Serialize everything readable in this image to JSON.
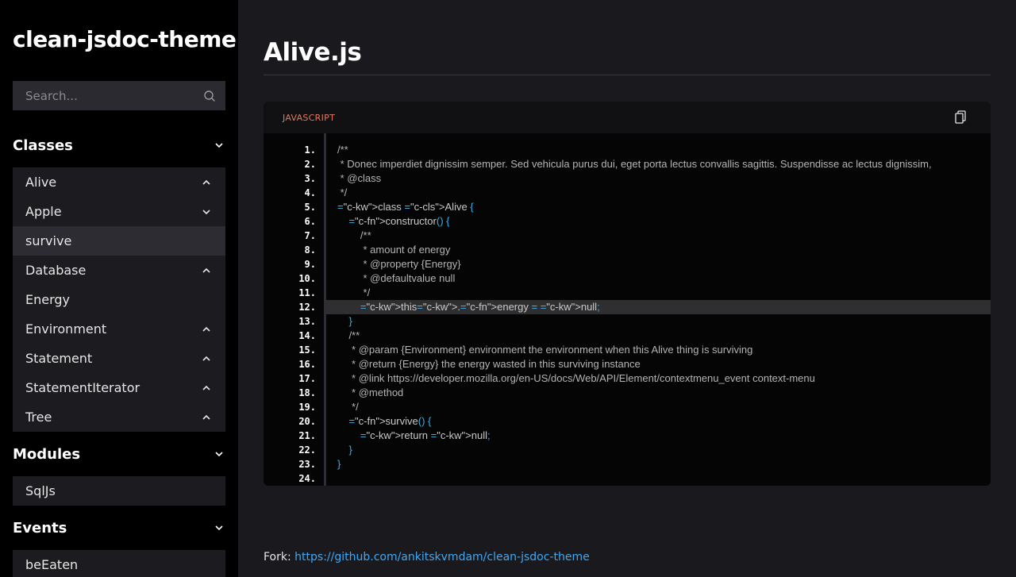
{
  "sidebar": {
    "project_title": "clean-jsdoc-theme",
    "search": {
      "placeholder": "Search..."
    },
    "sections": {
      "classes": {
        "title": "Classes"
      },
      "modules": {
        "title": "Modules"
      },
      "events": {
        "title": "Events"
      }
    },
    "classes_items": [
      {
        "label": "Alive",
        "chevron": "chevron-up"
      },
      {
        "label": "Apple",
        "chevron": "chevron-down"
      },
      {
        "label": "survive",
        "chevron": "none",
        "active": true
      },
      {
        "label": "Database",
        "chevron": "chevron-up"
      },
      {
        "label": "Energy",
        "chevron": "none"
      },
      {
        "label": "Environment",
        "chevron": "chevron-up"
      },
      {
        "label": "Statement",
        "chevron": "chevron-up"
      },
      {
        "label": "StatementIterator",
        "chevron": "chevron-up"
      },
      {
        "label": "Tree",
        "chevron": "chevron-up"
      }
    ],
    "modules_items": [
      {
        "label": "SqlJs"
      }
    ],
    "events_items": [
      {
        "label": "beEaten"
      }
    ]
  },
  "main": {
    "page_title": "Alive.js",
    "code": {
      "language": "JAVASCRIPT",
      "copy_icon": "copy-icon",
      "lines": [
        {
          "n": "1.",
          "text": "/**"
        },
        {
          "n": "2.",
          "text": " * Donec imperdiet dignissim semper. Sed vehicula purus dui, eget porta lectus convallis sagittis. Suspendisse ac lectus dignissim,"
        },
        {
          "n": "3.",
          "text": " * @class"
        },
        {
          "n": "4.",
          "text": " */"
        },
        {
          "n": "5.",
          "text": "class Alive {"
        },
        {
          "n": "6.",
          "text": "    constructor() {"
        },
        {
          "n": "7.",
          "text": "        /**"
        },
        {
          "n": "8.",
          "text": "         * amount of energy"
        },
        {
          "n": "9.",
          "text": "         * @property {Energy}"
        },
        {
          "n": "10.",
          "text": "         * @defaultvalue null"
        },
        {
          "n": "11.",
          "text": "         */"
        },
        {
          "n": "12.",
          "text": "        this.energy = null;"
        },
        {
          "n": "13.",
          "text": "    }"
        },
        {
          "n": "14.",
          "text": "    /**"
        },
        {
          "n": "15.",
          "text": "     * @param {Environment} environment the environment when this Alive thing is surviving"
        },
        {
          "n": "16.",
          "text": "     * @return {Energy} the energy wasted in this surviving instance"
        },
        {
          "n": "17.",
          "text": "     * @link https://developer.mozilla.org/en-US/docs/Web/API/Element/contextmenu_event context-menu"
        },
        {
          "n": "18.",
          "text": "     * @method"
        },
        {
          "n": "19.",
          "text": "     */"
        },
        {
          "n": "20.",
          "text": "    survive() {"
        },
        {
          "n": "21.",
          "text": "        return null;"
        },
        {
          "n": "22.",
          "text": "    }"
        },
        {
          "n": "23.",
          "text": "}"
        },
        {
          "n": "24.",
          "text": ""
        }
      ]
    }
  },
  "footer": {
    "prefix": "Fork: ",
    "link_text": "https://github.com/ankitskvmdam/clean-jsdoc-theme"
  }
}
